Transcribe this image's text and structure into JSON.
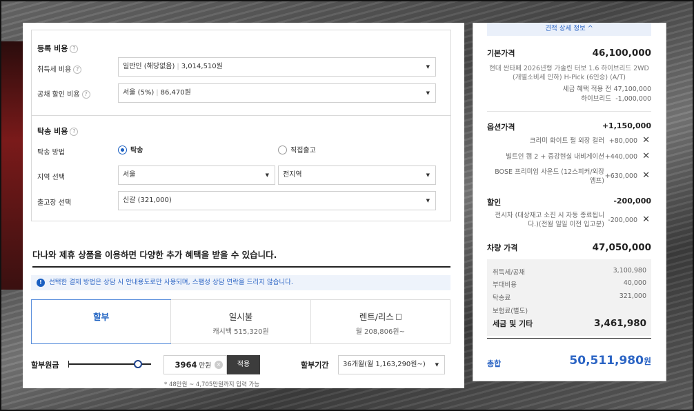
{
  "registration": {
    "title": "등록 비용",
    "acquisition_tax": {
      "label": "취득세 비용",
      "option": "일반인 (해당없음)",
      "amount": "3,014,510원"
    },
    "bond_discount": {
      "label": "공채 할인 비용",
      "option": "서울 (5%)",
      "amount": "86,470원"
    }
  },
  "delivery": {
    "title": "탁송 비용",
    "method_label": "탁송 방법",
    "method_options": [
      "탁송",
      "직접출고"
    ],
    "region_label": "지역 선택",
    "region_city": "서울",
    "region_district": "전지역",
    "factory_label": "출고장 선택",
    "factory_value": "신갈 (321,000)"
  },
  "promo": {
    "headline": "다나와 제휴 상품을 이용하면 다양한 추가 혜택을 받을 수 있습니다.",
    "notice": "선택한 결제 방법은 상담 시 안내용도로만 사용되며, 스팸성 상담 연락을 드리지 않습니다."
  },
  "payment_tabs": [
    {
      "label": "할부",
      "sub": ""
    },
    {
      "label": "일시불",
      "sub": "캐시백 515,320원"
    },
    {
      "label": "렌트/리스",
      "sub": "월 208,806원~"
    }
  ],
  "installment": {
    "principal_label": "할부원금",
    "slider_fraction": 0.84,
    "amount": "3964",
    "unit": "만원",
    "apply_label": "적용",
    "hint": "* 48만원 ~ 4,705만원까지 입력 가능",
    "period_label": "할부기간",
    "period_value": "36개월(월 1,163,290원~)"
  },
  "summary": {
    "detail_toggle": "견적 상세 정보 ^",
    "base_price": {
      "label": "기본가격",
      "value": "46,100,000"
    },
    "base_desc_1": "현대 싼타페 2026년형 가솔린 터보 1.6 하이브리드 2WD",
    "base_desc_2": "(개별소비세 인하) H-Pick (6인승) (A/T)",
    "tax_benefit": {
      "label": "세금 혜택 적용 전",
      "value": "47,100,000"
    },
    "hybrid": {
      "label": "하이브리드",
      "value": "-1,000,000"
    },
    "options": {
      "label": "옵션가격",
      "value": "+1,150,000"
    },
    "option_items": [
      {
        "name": "크리미 화이트 펄 외장 컬러",
        "price": "+80,000"
      },
      {
        "name": "빌트인 캠 2 + 증강현실 내비게이션",
        "price": "+440,000"
      },
      {
        "name": "BOSE 프리미엄 사운드 (12스피커/외장",
        "name2": "앰프)",
        "price": "+630,000"
      }
    ],
    "discount": {
      "label": "할인",
      "value": "-200,000"
    },
    "discount_item": {
      "name": "전시차 (대상재고 소진 시 자동 종료됩니",
      "name2": "다.)(전월 일일 이전 입고분)",
      "price": "-200,000"
    },
    "car_price": {
      "label": "차량 가격",
      "value": "47,050,000"
    },
    "fees": [
      {
        "label": "취득세/공채",
        "value": "3,100,980"
      },
      {
        "label": "부대비용",
        "value": "40,000"
      },
      {
        "label": "탁송료",
        "value": "321,000"
      },
      {
        "label": "보험료(별도)",
        "value": ""
      }
    ],
    "tax_etc": {
      "label": "세금 및 기타",
      "value": "3,461,980"
    },
    "total": {
      "label": "총합",
      "value": "50,511,980",
      "unit": "원"
    }
  },
  "colors": {
    "accent": "#1a5fc1",
    "dark_button": "#3c3c3c"
  }
}
